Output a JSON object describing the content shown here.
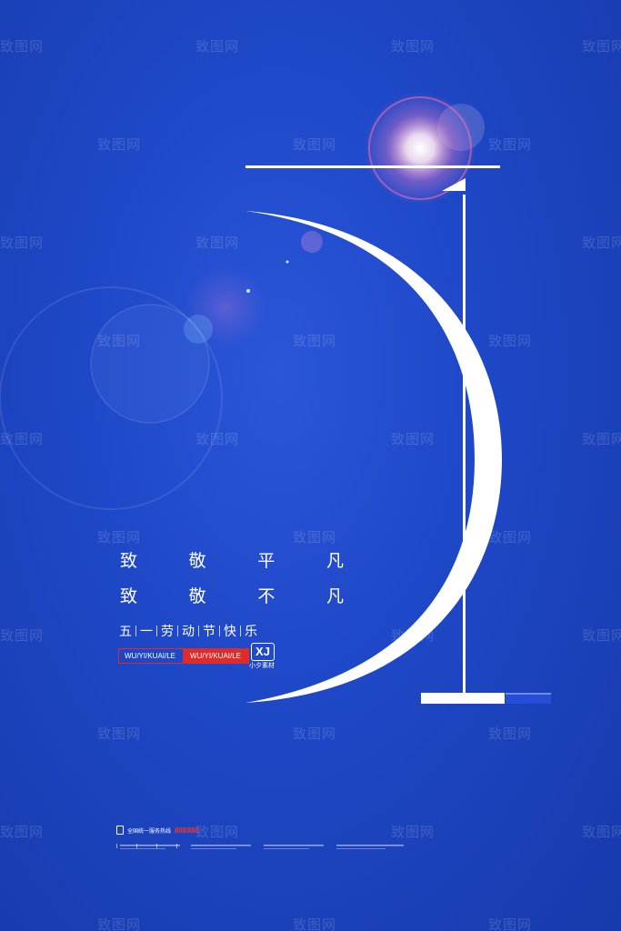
{
  "watermark_text": "致图网",
  "slogan": {
    "line1": [
      "致",
      "敬",
      "平",
      "凡"
    ],
    "line2": [
      "致",
      "敬",
      "不",
      "凡"
    ]
  },
  "festival": [
    "五",
    "一",
    "劳",
    "动",
    "节",
    "快",
    "乐"
  ],
  "pinyin": {
    "outline_label": "WU/YI/KUAI/LE",
    "filled_label": "WU/YI/KUAI/LE"
  },
  "logo": {
    "mark": "XJ",
    "caption": "小夕素材"
  },
  "footer": {
    "phone_label": "全国统一服务热线",
    "phone_number": "888888"
  },
  "colors": {
    "background": "#1f48c8",
    "foreground": "#ffffff",
    "accent_red": "#e02b2b"
  }
}
